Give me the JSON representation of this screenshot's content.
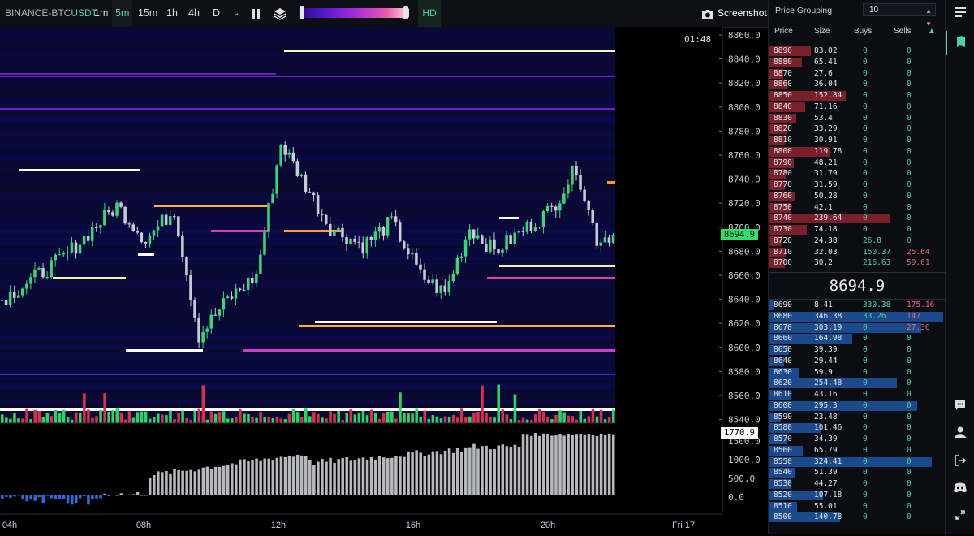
{
  "toolbar": {
    "symbol_prefix": "BINANCE-",
    "symbol_base": "BTC",
    "symbol_quote": "USDT",
    "timeframes": [
      "1m",
      "5m",
      "15m",
      "1h",
      "4h",
      "D"
    ],
    "active_timeframe": "5m",
    "chevron": "⌄",
    "hd_label": "HD",
    "screenshot_label": "Screenshot",
    "icons": [
      "bars-icon",
      "layers-icon",
      "camera-icon",
      "chevron-down-icon"
    ]
  },
  "chart": {
    "timer": "01:48",
    "current_price": "8694.9",
    "volume_cursor": "1770.9",
    "price_ticks": [
      "8860.0",
      "8840.0",
      "8820.0",
      "8800.0",
      "8780.0",
      "8760.0",
      "8740.0",
      "8720.0",
      "8700.0",
      "8680.0",
      "8660.0",
      "8640.0",
      "8620.0",
      "8600.0",
      "8580.0",
      "8560.0",
      "8540.0"
    ],
    "volume_ticks": [
      "1500.0",
      "1000.0",
      "500.0",
      "0.0"
    ],
    "time_ticks": [
      "04h",
      "08h",
      "12h",
      "16h",
      "20h",
      "Fri 17"
    ],
    "colors": {
      "up": "#3fd27a",
      "down": "#e0364a",
      "price_tag": "#2ee06a",
      "heatmap_bg": "#0b0b3a"
    }
  },
  "orderbook": {
    "grouping_label": "Price Grouping",
    "grouping_value": "10",
    "columns": [
      "Price",
      "Size",
      "Buys",
      "Sells"
    ],
    "sort_icon": "▲",
    "mid_price": "8694.9",
    "asks": [
      [
        "8890",
        "83.02",
        "0",
        "0"
      ],
      [
        "8880",
        "65.41",
        "0",
        "0"
      ],
      [
        "8870",
        "27.6",
        "0",
        "0"
      ],
      [
        "8860",
        "36.04",
        "0",
        "0"
      ],
      [
        "8850",
        "152.84",
        "0",
        "0"
      ],
      [
        "8840",
        "71.16",
        "0",
        "0"
      ],
      [
        "8830",
        "53.4",
        "0",
        "0"
      ],
      [
        "8820",
        "33.29",
        "0",
        "0"
      ],
      [
        "8810",
        "30.91",
        "0",
        "0"
      ],
      [
        "8800",
        "119.78",
        "0",
        "0"
      ],
      [
        "8790",
        "48.21",
        "0",
        "0"
      ],
      [
        "8780",
        "31.79",
        "0",
        "0"
      ],
      [
        "8770",
        "31.59",
        "0",
        "0"
      ],
      [
        "8760",
        "50.28",
        "0",
        "0"
      ],
      [
        "8750",
        "42.1",
        "0",
        "0"
      ],
      [
        "8740",
        "239.64",
        "0",
        "0"
      ],
      [
        "8730",
        "74.18",
        "0",
        "0"
      ],
      [
        "8720",
        "24.38",
        "26.8",
        "0"
      ],
      [
        "8710",
        "32.03",
        "150.37",
        "25.64"
      ],
      [
        "8700",
        "30.2",
        "216.63",
        "59.61"
      ]
    ],
    "bids": [
      [
        "8690",
        "8.41",
        "330.38",
        "175.16"
      ],
      [
        "8680",
        "346.38",
        "33.26",
        "147"
      ],
      [
        "8670",
        "303.19",
        "0",
        "27.36"
      ],
      [
        "8660",
        "164.98",
        "0",
        "0"
      ],
      [
        "8650",
        "39.39",
        "0",
        "0"
      ],
      [
        "8640",
        "29.44",
        "0",
        "0"
      ],
      [
        "8630",
        "59.9",
        "0",
        "0"
      ],
      [
        "8620",
        "254.48",
        "0",
        "0"
      ],
      [
        "8610",
        "43.16",
        "0",
        "0"
      ],
      [
        "8600",
        "295.3",
        "0",
        "0"
      ],
      [
        "8590",
        "23.48",
        "0",
        "0"
      ],
      [
        "8580",
        "101.46",
        "0",
        "0"
      ],
      [
        "8570",
        "34.39",
        "0",
        "0"
      ],
      [
        "8560",
        "65.79",
        "0",
        "0"
      ],
      [
        "8550",
        "324.41",
        "0",
        "0"
      ],
      [
        "8540",
        "51.39",
        "0",
        "0"
      ],
      [
        "8530",
        "44.27",
        "0",
        "0"
      ],
      [
        "8520",
        "107.18",
        "0",
        "0"
      ],
      [
        "8510",
        "55.01",
        "0",
        "0"
      ],
      [
        "8500",
        "140.78",
        "0",
        "0"
      ]
    ],
    "colors": {
      "ask": "#7a1f2c",
      "bid": "#1b4a8c",
      "buys": "#4fd1a5",
      "sells": "#e06a7a"
    }
  },
  "sidebar": {
    "icons": [
      "menu-icon",
      "book-icon",
      "chat-icon",
      "user-icon",
      "logout-icon",
      "discord-icon",
      "expand-icon"
    ]
  }
}
